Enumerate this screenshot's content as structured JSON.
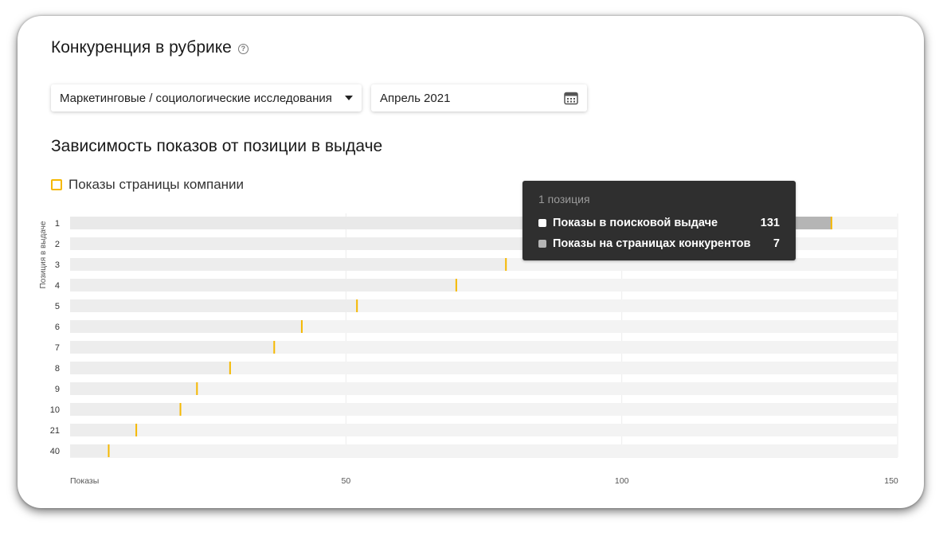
{
  "header": {
    "title": "Конкуренция в рубрике",
    "help_icon": "question-circle-icon"
  },
  "filters": {
    "category_value": "Маркетинговые / социологические исследования",
    "date_value": "Апрель 2021",
    "dropdown_icon": "caret-down-icon",
    "calendar_icon": "calendar-icon"
  },
  "section": {
    "title": "Зависимость показов от позиции в выдаче"
  },
  "legend": {
    "label": "Показы страницы компании",
    "color": "#f5b800"
  },
  "tooltip": {
    "title": "1 позиция",
    "rows": [
      {
        "label": "Показы в поисковой выдаче",
        "value": "131",
        "color": "#ffffff"
      },
      {
        "label": "Показы на страницах конкурентов",
        "value": "7",
        "color": "#b5b5b5"
      }
    ]
  },
  "chart_data": {
    "type": "bar",
    "orientation": "horizontal",
    "ylabel": "Позиция в выдаче",
    "xlabel": "Показы",
    "xlim": [
      0,
      150
    ],
    "xticks": [
      50,
      100,
      150
    ],
    "categories": [
      "1",
      "2",
      "3",
      "4",
      "5",
      "6",
      "7",
      "8",
      "9",
      "10",
      "21",
      "40"
    ],
    "series": [
      {
        "name": "Показы страницы компании",
        "values": [
          138,
          112,
          79,
          70,
          52,
          42,
          37,
          29,
          23,
          20,
          12,
          7
        ]
      }
    ],
    "grid": true,
    "colors": {
      "bar": "#ededed",
      "bar_highlight": "#b5b5b5",
      "marker": "#f5b800"
    }
  }
}
